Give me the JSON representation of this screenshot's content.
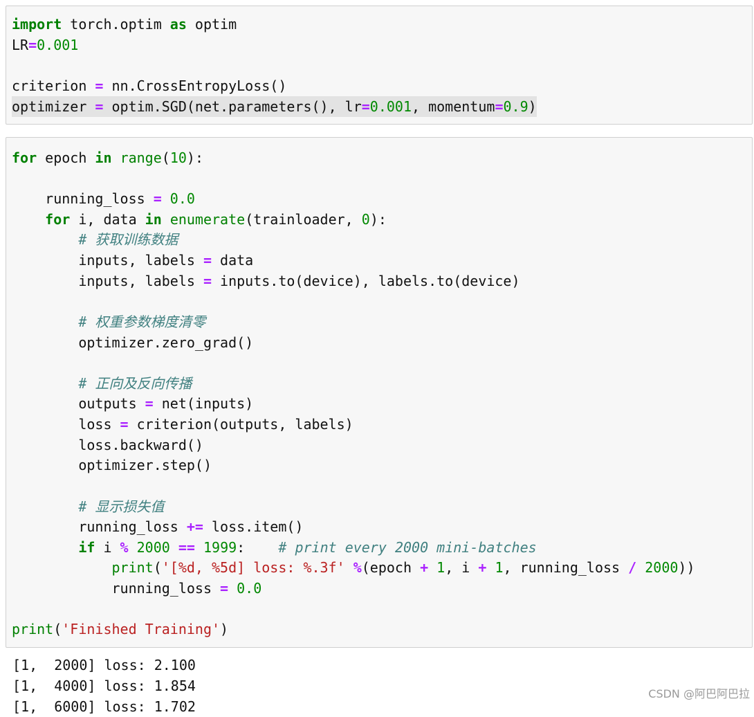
{
  "cells": [
    {
      "lines": [
        [
          {
            "t": "import",
            "c": "kw"
          },
          {
            "t": " torch.optim "
          },
          {
            "t": "as",
            "c": "kw"
          },
          {
            "t": " optim"
          }
        ],
        [
          {
            "t": "LR"
          },
          {
            "t": "=",
            "c": "op"
          },
          {
            "t": "0.001",
            "c": "num"
          }
        ],
        [],
        [
          {
            "t": "criterion "
          },
          {
            "t": "=",
            "c": "op"
          },
          {
            "t": " nn.CrossEntropyLoss()"
          }
        ],
        [
          {
            "t": "optimizer "
          },
          {
            "t": "=",
            "c": "op"
          },
          {
            "t": " optim.SGD(net.parameters(), lr"
          },
          {
            "t": "=",
            "c": "op"
          },
          {
            "t": "0.001",
            "c": "num"
          },
          {
            "t": ", momentum"
          },
          {
            "t": "=",
            "c": "op"
          },
          {
            "t": "0.9",
            "c": "num"
          },
          {
            "t": ")"
          }
        ]
      ],
      "highlight_line": 4
    },
    {
      "lines": [
        [
          {
            "t": "for",
            "c": "kw"
          },
          {
            "t": " epoch "
          },
          {
            "t": "in",
            "c": "kw"
          },
          {
            "t": " "
          },
          {
            "t": "range",
            "c": "bi"
          },
          {
            "t": "("
          },
          {
            "t": "10",
            "c": "num"
          },
          {
            "t": "):"
          }
        ],
        [],
        [
          {
            "t": "    running_loss "
          },
          {
            "t": "=",
            "c": "op"
          },
          {
            "t": " "
          },
          {
            "t": "0.0",
            "c": "num"
          }
        ],
        [
          {
            "t": "    "
          },
          {
            "t": "for",
            "c": "kw"
          },
          {
            "t": " i, data "
          },
          {
            "t": "in",
            "c": "kw"
          },
          {
            "t": " "
          },
          {
            "t": "enumerate",
            "c": "bi"
          },
          {
            "t": "(trainloader, "
          },
          {
            "t": "0",
            "c": "num"
          },
          {
            "t": "):"
          }
        ],
        [
          {
            "t": "        "
          },
          {
            "t": "# 获取训练数据",
            "c": "cm"
          }
        ],
        [
          {
            "t": "        inputs, labels "
          },
          {
            "t": "=",
            "c": "op"
          },
          {
            "t": " data"
          }
        ],
        [
          {
            "t": "        inputs, labels "
          },
          {
            "t": "=",
            "c": "op"
          },
          {
            "t": " inputs.to(device), labels.to(device)"
          }
        ],
        [],
        [
          {
            "t": "        "
          },
          {
            "t": "# 权重参数梯度清零",
            "c": "cm"
          }
        ],
        [
          {
            "t": "        optimizer.zero_grad()"
          }
        ],
        [],
        [
          {
            "t": "        "
          },
          {
            "t": "# 正向及反向传播",
            "c": "cm"
          }
        ],
        [
          {
            "t": "        outputs "
          },
          {
            "t": "=",
            "c": "op"
          },
          {
            "t": " net(inputs)"
          }
        ],
        [
          {
            "t": "        loss "
          },
          {
            "t": "=",
            "c": "op"
          },
          {
            "t": " criterion(outputs, labels)"
          }
        ],
        [
          {
            "t": "        loss.backward()"
          }
        ],
        [
          {
            "t": "        optimizer.step()"
          }
        ],
        [],
        [
          {
            "t": "        "
          },
          {
            "t": "# 显示损失值",
            "c": "cm"
          }
        ],
        [
          {
            "t": "        running_loss "
          },
          {
            "t": "+=",
            "c": "op"
          },
          {
            "t": " loss.item()"
          }
        ],
        [
          {
            "t": "        "
          },
          {
            "t": "if",
            "c": "kw"
          },
          {
            "t": " i "
          },
          {
            "t": "%",
            "c": "op"
          },
          {
            "t": " "
          },
          {
            "t": "2000",
            "c": "num"
          },
          {
            "t": " "
          },
          {
            "t": "==",
            "c": "op"
          },
          {
            "t": " "
          },
          {
            "t": "1999",
            "c": "num"
          },
          {
            "t": ":    "
          },
          {
            "t": "# print every 2000 mini-batches",
            "c": "cm"
          }
        ],
        [
          {
            "t": "            "
          },
          {
            "t": "print",
            "c": "bi"
          },
          {
            "t": "("
          },
          {
            "t": "'[%d, %5d] loss: %.3f'",
            "c": "str"
          },
          {
            "t": " "
          },
          {
            "t": "%",
            "c": "op"
          },
          {
            "t": "(epoch "
          },
          {
            "t": "+",
            "c": "op"
          },
          {
            "t": " "
          },
          {
            "t": "1",
            "c": "num"
          },
          {
            "t": ", i "
          },
          {
            "t": "+",
            "c": "op"
          },
          {
            "t": " "
          },
          {
            "t": "1",
            "c": "num"
          },
          {
            "t": ", running_loss "
          },
          {
            "t": "/",
            "c": "op"
          },
          {
            "t": " "
          },
          {
            "t": "2000",
            "c": "num"
          },
          {
            "t": "))"
          }
        ],
        [
          {
            "t": "            running_loss "
          },
          {
            "t": "=",
            "c": "op"
          },
          {
            "t": " "
          },
          {
            "t": "0.0",
            "c": "num"
          }
        ],
        [],
        [
          {
            "t": "print",
            "c": "bi"
          },
          {
            "t": "("
          },
          {
            "t": "'Finished Training'",
            "c": "str"
          },
          {
            "t": ")"
          }
        ]
      ],
      "highlight_line": -1
    }
  ],
  "output": [
    "[1,  2000] loss: 2.100",
    "[1,  4000] loss: 1.854",
    "[1,  6000] loss: 1.702"
  ],
  "watermark": "CSDN @阿巴阿巴拉"
}
